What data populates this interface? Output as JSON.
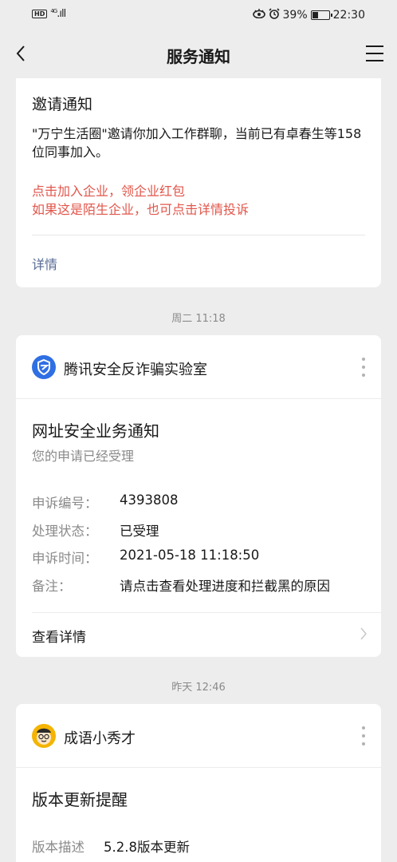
{
  "status_bar": {
    "network": "HD",
    "signal": "4G",
    "icons": [
      "eye-icon",
      "alarm-icon"
    ],
    "battery": "39%",
    "battery_level": 0.39,
    "time": "22:30"
  },
  "nav": {
    "title": "服务通知",
    "back_icon": "chevron-left-icon",
    "menu_icon": "menu-icon"
  },
  "invite_card": {
    "title": "邀请通知",
    "body": "\"万宁生活圈\"邀请你加入工作群聊，当前已有卓春生等158位同事加入。",
    "warn_line1": "点击加入企业，领企业红包",
    "warn_line2": "如果这是陌生企业，也可点击详情投诉",
    "detail_link": "详情"
  },
  "timestamps": [
    "周二 11:18",
    "昨天 12:46"
  ],
  "security_card": {
    "sender": "腾讯安全反诈骗实验室",
    "title": "网址安全业务通知",
    "subtitle": "您的申请已经受理",
    "fields": [
      {
        "label": "申诉编号：",
        "value": "4393808"
      },
      {
        "label": "处理状态：",
        "value": "已受理"
      },
      {
        "label": "申诉时间：",
        "value": "2021-05-18 11:18:50"
      },
      {
        "label": "备注：",
        "value": "请点击查看处理进度和拦截黑的原因"
      }
    ],
    "view_detail": "查看详情"
  },
  "idiom_card": {
    "sender": "成语小秀才",
    "title": "版本更新提醒",
    "fields": [
      {
        "label": "版本描述",
        "value": "5.2.8版本更新"
      }
    ]
  },
  "colors": {
    "background": "#ededed",
    "warning": "#e2564b",
    "link": "#576b95",
    "secondary_text": "#8a8a8a"
  }
}
